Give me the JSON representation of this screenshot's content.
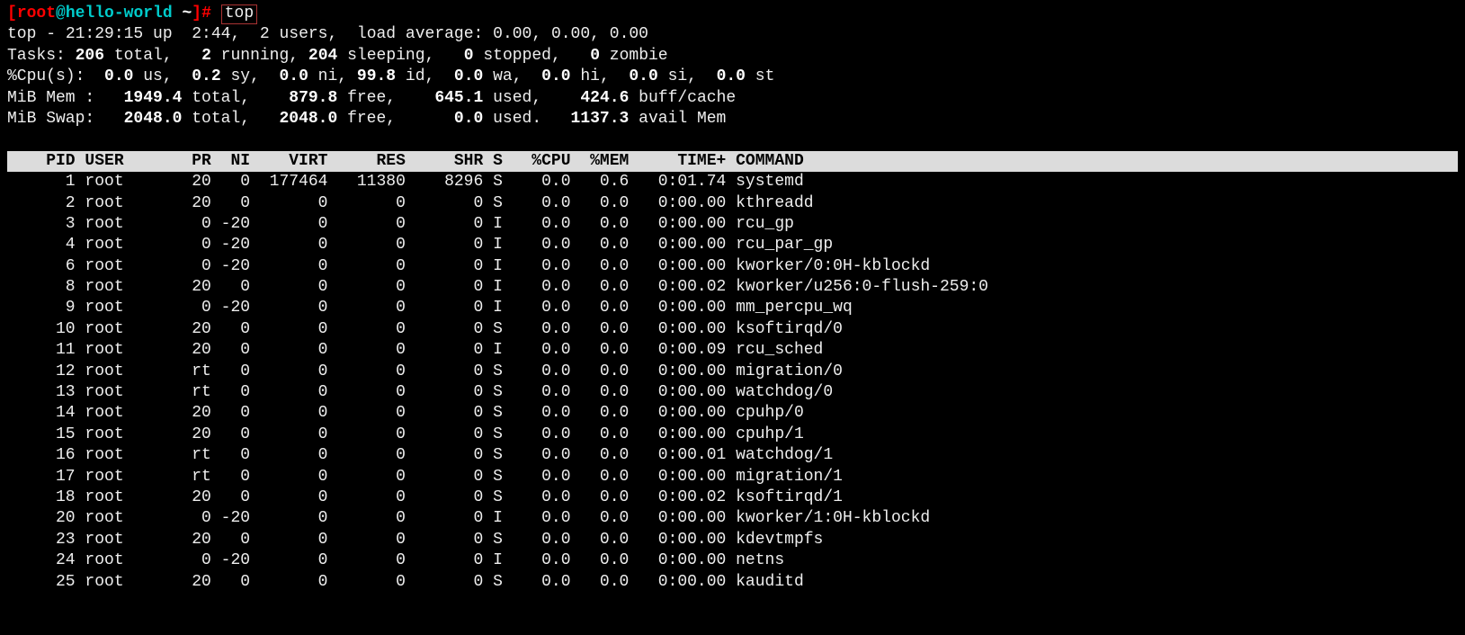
{
  "prompt": {
    "user": "root",
    "at": "@",
    "host": "hello-world",
    "cwd": "~",
    "command": "top"
  },
  "summary": {
    "line1": {
      "prefix": "top - ",
      "time": "21:29:15",
      "up_label": " up  ",
      "uptime": "2:44",
      "users_sep": ",  ",
      "users": "2 users",
      "load_label": ",  load average: ",
      "load": "0.00, 0.00, 0.00"
    },
    "tasks": {
      "label": "Tasks: ",
      "total": "206",
      "total_lbl": " total,   ",
      "running": "2",
      "running_lbl": " running, ",
      "sleeping": "204",
      "sleeping_lbl": " sleeping,   ",
      "stopped": "0",
      "stopped_lbl": " stopped,   ",
      "zombie": "0",
      "zombie_lbl": " zombie"
    },
    "cpu": {
      "label": "%Cpu(s):  ",
      "us": "0.0",
      "us_lbl": " us,  ",
      "sy": "0.2",
      "sy_lbl": " sy,  ",
      "ni": "0.0",
      "ni_lbl": " ni, ",
      "id": "99.8",
      "id_lbl": " id,  ",
      "wa": "0.0",
      "wa_lbl": " wa,  ",
      "hi": "0.0",
      "hi_lbl": " hi,  ",
      "si": "0.0",
      "si_lbl": " si,  ",
      "st": "0.0",
      "st_lbl": " st"
    },
    "mem": {
      "label": "MiB Mem :   ",
      "total": "1949.4",
      "total_lbl": " total,    ",
      "free": "879.8",
      "free_lbl": " free,    ",
      "used": "645.1",
      "used_lbl": " used,    ",
      "buff": "424.6",
      "buff_lbl": " buff/cache"
    },
    "swap": {
      "label": "MiB Swap:   ",
      "total": "2048.0",
      "total_lbl": " total,   ",
      "free": "2048.0",
      "free_lbl": " free,      ",
      "used": "0.0",
      "used_lbl": " used.   ",
      "avail": "1137.3",
      "avail_lbl": " avail Mem"
    }
  },
  "columns": [
    "PID",
    "USER",
    "PR",
    "NI",
    "VIRT",
    "RES",
    "SHR",
    "S",
    "%CPU",
    "%MEM",
    "TIME+",
    "COMMAND"
  ],
  "processes": [
    {
      "pid": "1",
      "user": "root",
      "pr": "20",
      "ni": "0",
      "virt": "177464",
      "res": "11380",
      "shr": "8296",
      "s": "S",
      "cpu": "0.0",
      "mem": "0.6",
      "time": "0:01.74",
      "cmd": "systemd"
    },
    {
      "pid": "2",
      "user": "root",
      "pr": "20",
      "ni": "0",
      "virt": "0",
      "res": "0",
      "shr": "0",
      "s": "S",
      "cpu": "0.0",
      "mem": "0.0",
      "time": "0:00.00",
      "cmd": "kthreadd"
    },
    {
      "pid": "3",
      "user": "root",
      "pr": "0",
      "ni": "-20",
      "virt": "0",
      "res": "0",
      "shr": "0",
      "s": "I",
      "cpu": "0.0",
      "mem": "0.0",
      "time": "0:00.00",
      "cmd": "rcu_gp"
    },
    {
      "pid": "4",
      "user": "root",
      "pr": "0",
      "ni": "-20",
      "virt": "0",
      "res": "0",
      "shr": "0",
      "s": "I",
      "cpu": "0.0",
      "mem": "0.0",
      "time": "0:00.00",
      "cmd": "rcu_par_gp"
    },
    {
      "pid": "6",
      "user": "root",
      "pr": "0",
      "ni": "-20",
      "virt": "0",
      "res": "0",
      "shr": "0",
      "s": "I",
      "cpu": "0.0",
      "mem": "0.0",
      "time": "0:00.00",
      "cmd": "kworker/0:0H-kblockd"
    },
    {
      "pid": "8",
      "user": "root",
      "pr": "20",
      "ni": "0",
      "virt": "0",
      "res": "0",
      "shr": "0",
      "s": "I",
      "cpu": "0.0",
      "mem": "0.0",
      "time": "0:00.02",
      "cmd": "kworker/u256:0-flush-259:0"
    },
    {
      "pid": "9",
      "user": "root",
      "pr": "0",
      "ni": "-20",
      "virt": "0",
      "res": "0",
      "shr": "0",
      "s": "I",
      "cpu": "0.0",
      "mem": "0.0",
      "time": "0:00.00",
      "cmd": "mm_percpu_wq"
    },
    {
      "pid": "10",
      "user": "root",
      "pr": "20",
      "ni": "0",
      "virt": "0",
      "res": "0",
      "shr": "0",
      "s": "S",
      "cpu": "0.0",
      "mem": "0.0",
      "time": "0:00.00",
      "cmd": "ksoftirqd/0"
    },
    {
      "pid": "11",
      "user": "root",
      "pr": "20",
      "ni": "0",
      "virt": "0",
      "res": "0",
      "shr": "0",
      "s": "I",
      "cpu": "0.0",
      "mem": "0.0",
      "time": "0:00.09",
      "cmd": "rcu_sched"
    },
    {
      "pid": "12",
      "user": "root",
      "pr": "rt",
      "ni": "0",
      "virt": "0",
      "res": "0",
      "shr": "0",
      "s": "S",
      "cpu": "0.0",
      "mem": "0.0",
      "time": "0:00.00",
      "cmd": "migration/0"
    },
    {
      "pid": "13",
      "user": "root",
      "pr": "rt",
      "ni": "0",
      "virt": "0",
      "res": "0",
      "shr": "0",
      "s": "S",
      "cpu": "0.0",
      "mem": "0.0",
      "time": "0:00.00",
      "cmd": "watchdog/0"
    },
    {
      "pid": "14",
      "user": "root",
      "pr": "20",
      "ni": "0",
      "virt": "0",
      "res": "0",
      "shr": "0",
      "s": "S",
      "cpu": "0.0",
      "mem": "0.0",
      "time": "0:00.00",
      "cmd": "cpuhp/0"
    },
    {
      "pid": "15",
      "user": "root",
      "pr": "20",
      "ni": "0",
      "virt": "0",
      "res": "0",
      "shr": "0",
      "s": "S",
      "cpu": "0.0",
      "mem": "0.0",
      "time": "0:00.00",
      "cmd": "cpuhp/1"
    },
    {
      "pid": "16",
      "user": "root",
      "pr": "rt",
      "ni": "0",
      "virt": "0",
      "res": "0",
      "shr": "0",
      "s": "S",
      "cpu": "0.0",
      "mem": "0.0",
      "time": "0:00.01",
      "cmd": "watchdog/1"
    },
    {
      "pid": "17",
      "user": "root",
      "pr": "rt",
      "ni": "0",
      "virt": "0",
      "res": "0",
      "shr": "0",
      "s": "S",
      "cpu": "0.0",
      "mem": "0.0",
      "time": "0:00.00",
      "cmd": "migration/1"
    },
    {
      "pid": "18",
      "user": "root",
      "pr": "20",
      "ni": "0",
      "virt": "0",
      "res": "0",
      "shr": "0",
      "s": "S",
      "cpu": "0.0",
      "mem": "0.0",
      "time": "0:00.02",
      "cmd": "ksoftirqd/1"
    },
    {
      "pid": "20",
      "user": "root",
      "pr": "0",
      "ni": "-20",
      "virt": "0",
      "res": "0",
      "shr": "0",
      "s": "I",
      "cpu": "0.0",
      "mem": "0.0",
      "time": "0:00.00",
      "cmd": "kworker/1:0H-kblockd"
    },
    {
      "pid": "23",
      "user": "root",
      "pr": "20",
      "ni": "0",
      "virt": "0",
      "res": "0",
      "shr": "0",
      "s": "S",
      "cpu": "0.0",
      "mem": "0.0",
      "time": "0:00.00",
      "cmd": "kdevtmpfs"
    },
    {
      "pid": "24",
      "user": "root",
      "pr": "0",
      "ni": "-20",
      "virt": "0",
      "res": "0",
      "shr": "0",
      "s": "I",
      "cpu": "0.0",
      "mem": "0.0",
      "time": "0:00.00",
      "cmd": "netns"
    },
    {
      "pid": "25",
      "user": "root",
      "pr": "20",
      "ni": "0",
      "virt": "0",
      "res": "0",
      "shr": "0",
      "s": "S",
      "cpu": "0.0",
      "mem": "0.0",
      "time": "0:00.00",
      "cmd": "kauditd"
    }
  ]
}
